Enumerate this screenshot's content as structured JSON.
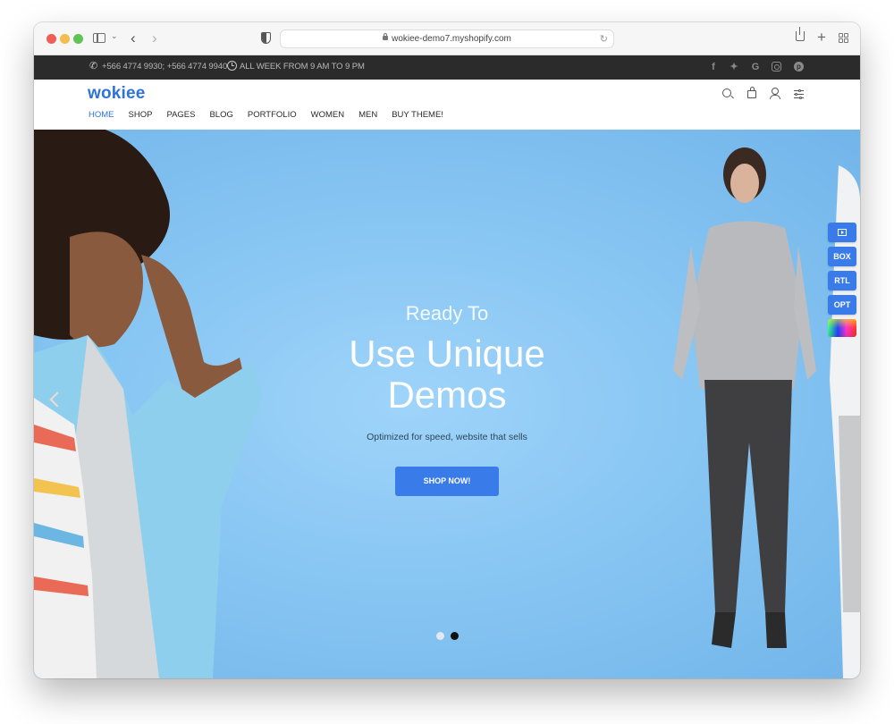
{
  "browser": {
    "url": "wokiee-demo7.myshopify.com",
    "icons": [
      "close",
      "minimize",
      "maximize",
      "sidebar-icon",
      "chevron-down-icon",
      "back-icon",
      "forward-icon",
      "privacy-shield-icon",
      "lock-icon",
      "reload-icon",
      "share-icon",
      "new-tab-icon",
      "tab-overview-icon"
    ]
  },
  "topbar": {
    "phones": "+566 4774 9930; +566 4774 9940",
    "hours": "ALL WEEK FROM 9 AM TO 9 PM",
    "social": [
      {
        "name": "facebook",
        "glyph": "f"
      },
      {
        "name": "twitter",
        "glyph": "🐦"
      },
      {
        "name": "google",
        "glyph": "G"
      },
      {
        "name": "instagram",
        "glyph": ""
      },
      {
        "name": "pinterest",
        "glyph": "p"
      }
    ]
  },
  "header": {
    "logo": "wokiee",
    "nav": [
      {
        "label": "HOME",
        "active": true
      },
      {
        "label": "SHOP"
      },
      {
        "label": "PAGES"
      },
      {
        "label": "BLOG"
      },
      {
        "label": "PORTFOLIO"
      },
      {
        "label": "WOMEN"
      },
      {
        "label": "MEN"
      },
      {
        "label": "BUY THEME!"
      }
    ],
    "icons": [
      "search",
      "cart",
      "account",
      "settings"
    ]
  },
  "hero": {
    "subtitle": "Ready To",
    "title_line1": "Use Unique",
    "title_line2": "Demos",
    "description": "Optimized for speed, website that sells",
    "cta": "SHOP NOW!",
    "slides": 2,
    "active_slide": 2
  },
  "side_tools": {
    "buttons": [
      "BOX",
      "RTL",
      "OPT"
    ]
  },
  "colors": {
    "accent": "#2e74d8",
    "button": "#3a7bea",
    "topbar_bg": "#2b2b2b",
    "hero_bg": "#88c6f3"
  }
}
